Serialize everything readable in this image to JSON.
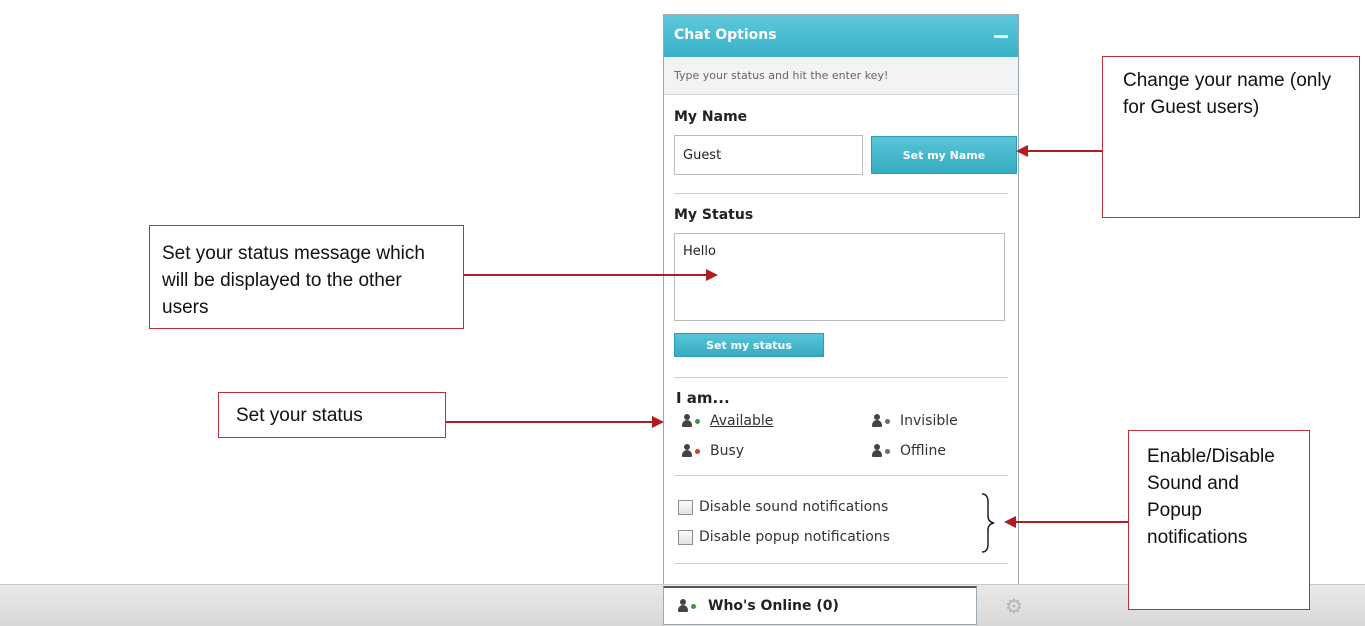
{
  "panel": {
    "title": "Chat Options",
    "hint": "Type your status and hit the enter key!",
    "my_name_label": "My Name",
    "name_value": "Guest",
    "set_name_button": "Set my Name",
    "my_status_label": "My Status",
    "status_value": "Hello",
    "set_status_button": "Set my status",
    "iam_label": "I am...",
    "statuses": [
      {
        "label": "Available",
        "dot_color": "#2e9b3c",
        "selected": true
      },
      {
        "label": "Invisible",
        "dot_color": "#6a6a6a",
        "selected": false
      },
      {
        "label": "Busy",
        "dot_color": "#d53a2a",
        "selected": false
      },
      {
        "label": "Offline",
        "dot_color": "#6a6a6a",
        "selected": false
      }
    ],
    "notifications": [
      {
        "label": "Disable sound notifications",
        "checked": false
      },
      {
        "label": "Disable popup notifications",
        "checked": false
      }
    ]
  },
  "footer": {
    "whos_online": "Who's Online (0)",
    "settings_icon": "gear-icon"
  },
  "callouts": {
    "change_name": "Change your name (only for Guest users)",
    "status_message": "Set your status message which will be displayed to the other users",
    "set_status": "Set your status",
    "notifications": "Enable/Disable Sound and Popup notifications"
  },
  "colors": {
    "header": "#37b2c8",
    "callout_border": "#c0303a",
    "arrow": "#b01c22"
  }
}
